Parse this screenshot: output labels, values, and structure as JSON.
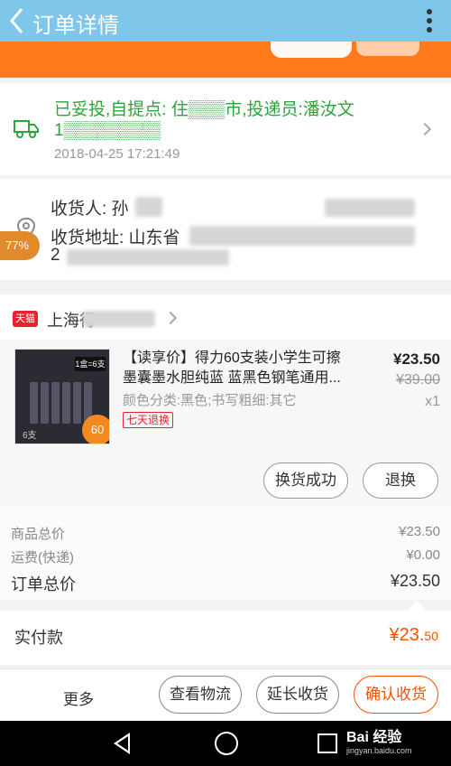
{
  "header": {
    "title": "订单详情"
  },
  "logistics": {
    "status_line1": "已妥投,自提点: 住▒▒▒市,投递员:潘汝文",
    "status_line2": "1▒▒▒▒▒▒▒▒",
    "time": "2018-04-25 17:21:49"
  },
  "address": {
    "receiver_label": "收货人: 孙",
    "address_label": "收货地址: 山东省",
    "address_line2": "2",
    "progress_badge": "77%"
  },
  "shop": {
    "badge": "天猫",
    "name": "上海得"
  },
  "product": {
    "title_line1": "【读享价】得力60支装小学生可擦",
    "title_line2": "墨囊墨水胆纯蓝 蓝黑色钢笔通用...",
    "spec": "颜色分类:黑色;书写粗细:其它",
    "tag": "七天退换",
    "price": "¥23.50",
    "original_price": "¥39.00",
    "quantity": "x1",
    "thumb_label": "1盒=6支",
    "thumb_badge": "60",
    "thumb_count": "6支",
    "btn_exchange_done": "换货成功",
    "btn_return": "退换"
  },
  "summary": {
    "goods_total_label": "商品总价",
    "goods_total": "¥23.50",
    "shipping_label": "运费(快递)",
    "shipping": "¥0.00",
    "order_total_label": "订单总价",
    "order_total": "¥23.50"
  },
  "payment": {
    "label": "实付款",
    "amount_main": "¥23.",
    "amount_cents": "50"
  },
  "actions": {
    "more": "更多",
    "view_logistics": "查看物流",
    "extend_receipt": "延长收货",
    "confirm_receipt": "确认收货"
  },
  "watermark": {
    "text": "Bai 经验",
    "url": "jingyan.baidu.com"
  },
  "colors": {
    "topbar": "#7ec6ea",
    "accent": "#ff5000",
    "green": "#2ea43c",
    "tmall": "#e8232f"
  }
}
